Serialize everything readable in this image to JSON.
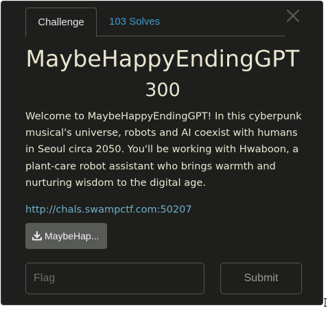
{
  "tabs": {
    "challenge": "Challenge",
    "solves": "103 Solves"
  },
  "challenge": {
    "name": "MaybeHappyEndingGPT",
    "points": "300",
    "description": "Welcome to MaybeHappyEndingGPT! In this cyberpunk musical's universe, robots and AI coexist with humans in Seoul circa 2050. You'll be working with Hwaboon, a plant-care robot assistant who brings warmth and nurturing wisdom to the digital age.",
    "link": "http://chals.swampctf.com:50207",
    "file_label": "MaybeHap..."
  },
  "form": {
    "flag_placeholder": "Flag",
    "flag_value": "",
    "submit_label": "Submit"
  },
  "icons": {
    "close": "close-icon",
    "download": "download-icon"
  },
  "colors": {
    "background": "#1e1f1d",
    "text": "#e8e6cf",
    "link": "#3d9bcf",
    "file_button": "#585a57"
  }
}
